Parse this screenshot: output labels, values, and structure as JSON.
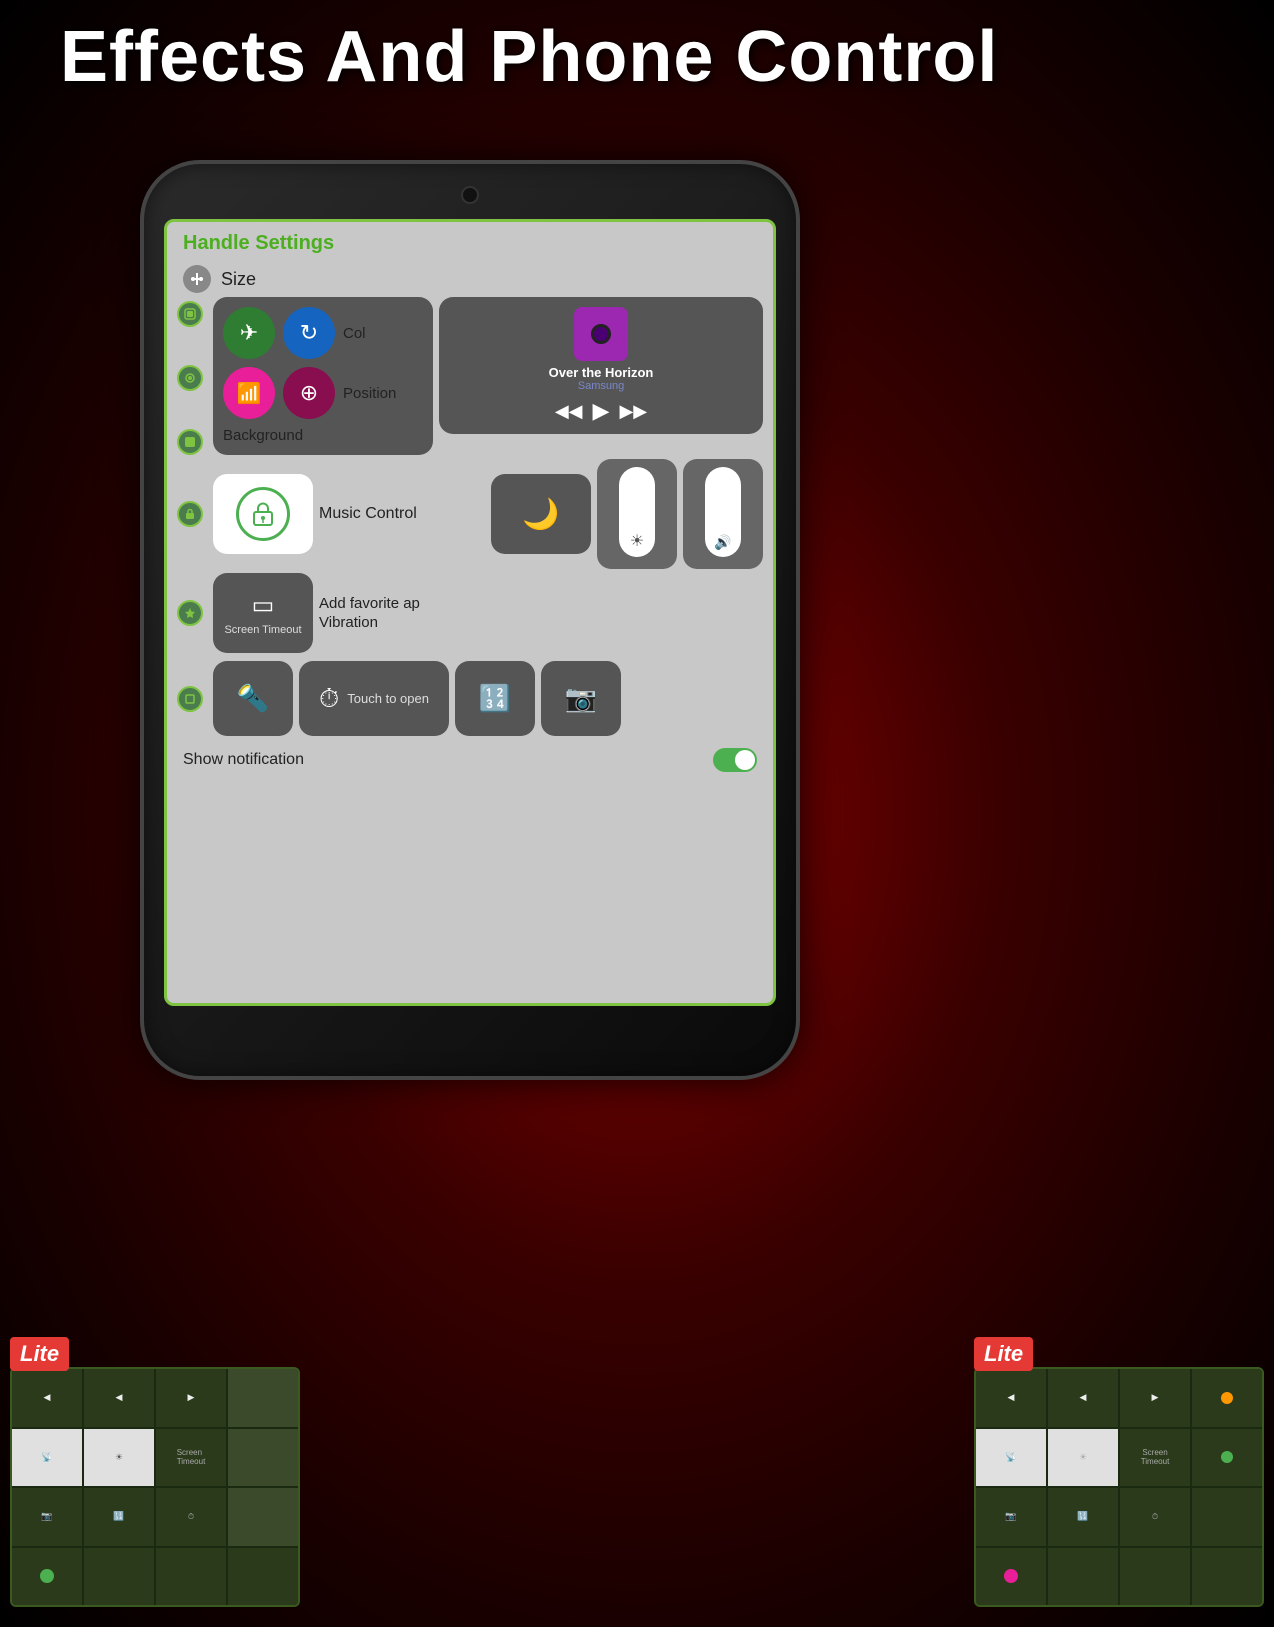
{
  "page": {
    "title": "Effects And Phone Control",
    "background": "#8b0000"
  },
  "phone": {
    "screen": {
      "handle_settings": "Handle Settings",
      "size_label": "Size",
      "col_label": "Col",
      "position_label": "Position",
      "background_label": "Background",
      "music_control_label": "Music Control",
      "add_favorite_label": "Add favorite ap",
      "screen_timeout_label": "Screen Timeout",
      "vibration_label": "Vibration",
      "touch_open_label": "Touch to open",
      "show_notification_label": "Show notification",
      "music_title": "Over the Horizon",
      "music_artist": "Samsung"
    }
  },
  "thumbnails": {
    "left_badge": "Lite",
    "right_badge": "Lite"
  },
  "icons": {
    "airplane": "✈",
    "refresh": "↻",
    "wifi": "📶",
    "bluetooth": "⊕",
    "lock": "🔒",
    "moon": "🌙",
    "flashlight": "🔦",
    "timer": "⏱",
    "calculator": "🔢",
    "camera": "📷",
    "brightness": "☀",
    "volume": "🔊",
    "cast": "▭",
    "prev": "◀◀",
    "play": "▶",
    "next": "▶▶"
  }
}
